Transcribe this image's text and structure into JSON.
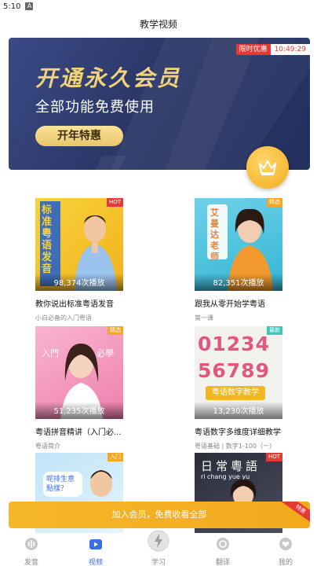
{
  "status_bar": {
    "time": "5:10",
    "notification_icon": "a-notification-icon"
  },
  "header": {
    "title": "教学视频"
  },
  "banner": {
    "headline": "开通永久会员",
    "subline": "全部功能免费使用",
    "button_label": "开年特惠",
    "promo_tag": "限时优惠",
    "countdown": "10:49:29"
  },
  "videos": [
    {
      "plays": "98,374次播放",
      "title": "教你说出标准粤语发音",
      "subtitle": "小白必备的入门粤语",
      "badge": "HOT",
      "thumb_text": "标准粤语发音"
    },
    {
      "plays": "82,351次播放",
      "title": "跟我从零开始学粤语",
      "subtitle": "第一课",
      "badge": "精选",
      "thumb_text": "艾曼达老师"
    },
    {
      "plays": "51,235次播放",
      "title": "粤语拼音精讲（入门必...",
      "subtitle": "粤语简介",
      "badge": "精选",
      "thumb_text_left": "入門",
      "thumb_text_right": "必學"
    },
    {
      "plays": "13,230次播放",
      "title": "粤语数字多维度详细教学",
      "subtitle": "粤语基础 | 数字1-100（一）",
      "badge": "最新",
      "thumb_text": "粤语数字教学",
      "thumb_digits": "01234 56789"
    },
    {
      "badge": "入门",
      "thumb_text": "呢排生意 點樣？"
    },
    {
      "badge": "HOT",
      "thumb_text": "日常粵語",
      "thumb_romanization": "ri chang yue yu"
    }
  ],
  "cta": {
    "label": "加入会员，免费收看全部",
    "corner_tag": "特惠"
  },
  "nav": [
    {
      "label": "发音",
      "icon": "sound-icon",
      "active": false
    },
    {
      "label": "视频",
      "icon": "video-icon",
      "active": true
    },
    {
      "label": "学习",
      "icon": "lightning-icon",
      "active": false
    },
    {
      "label": "翻译",
      "icon": "translate-icon",
      "active": false
    },
    {
      "label": "我的",
      "icon": "heart-icon",
      "active": false
    }
  ],
  "colors": {
    "accent": "#f5a623",
    "active_tab": "#3a6fe8",
    "hot": "#e53935",
    "banner_bg": "#2b3767"
  }
}
